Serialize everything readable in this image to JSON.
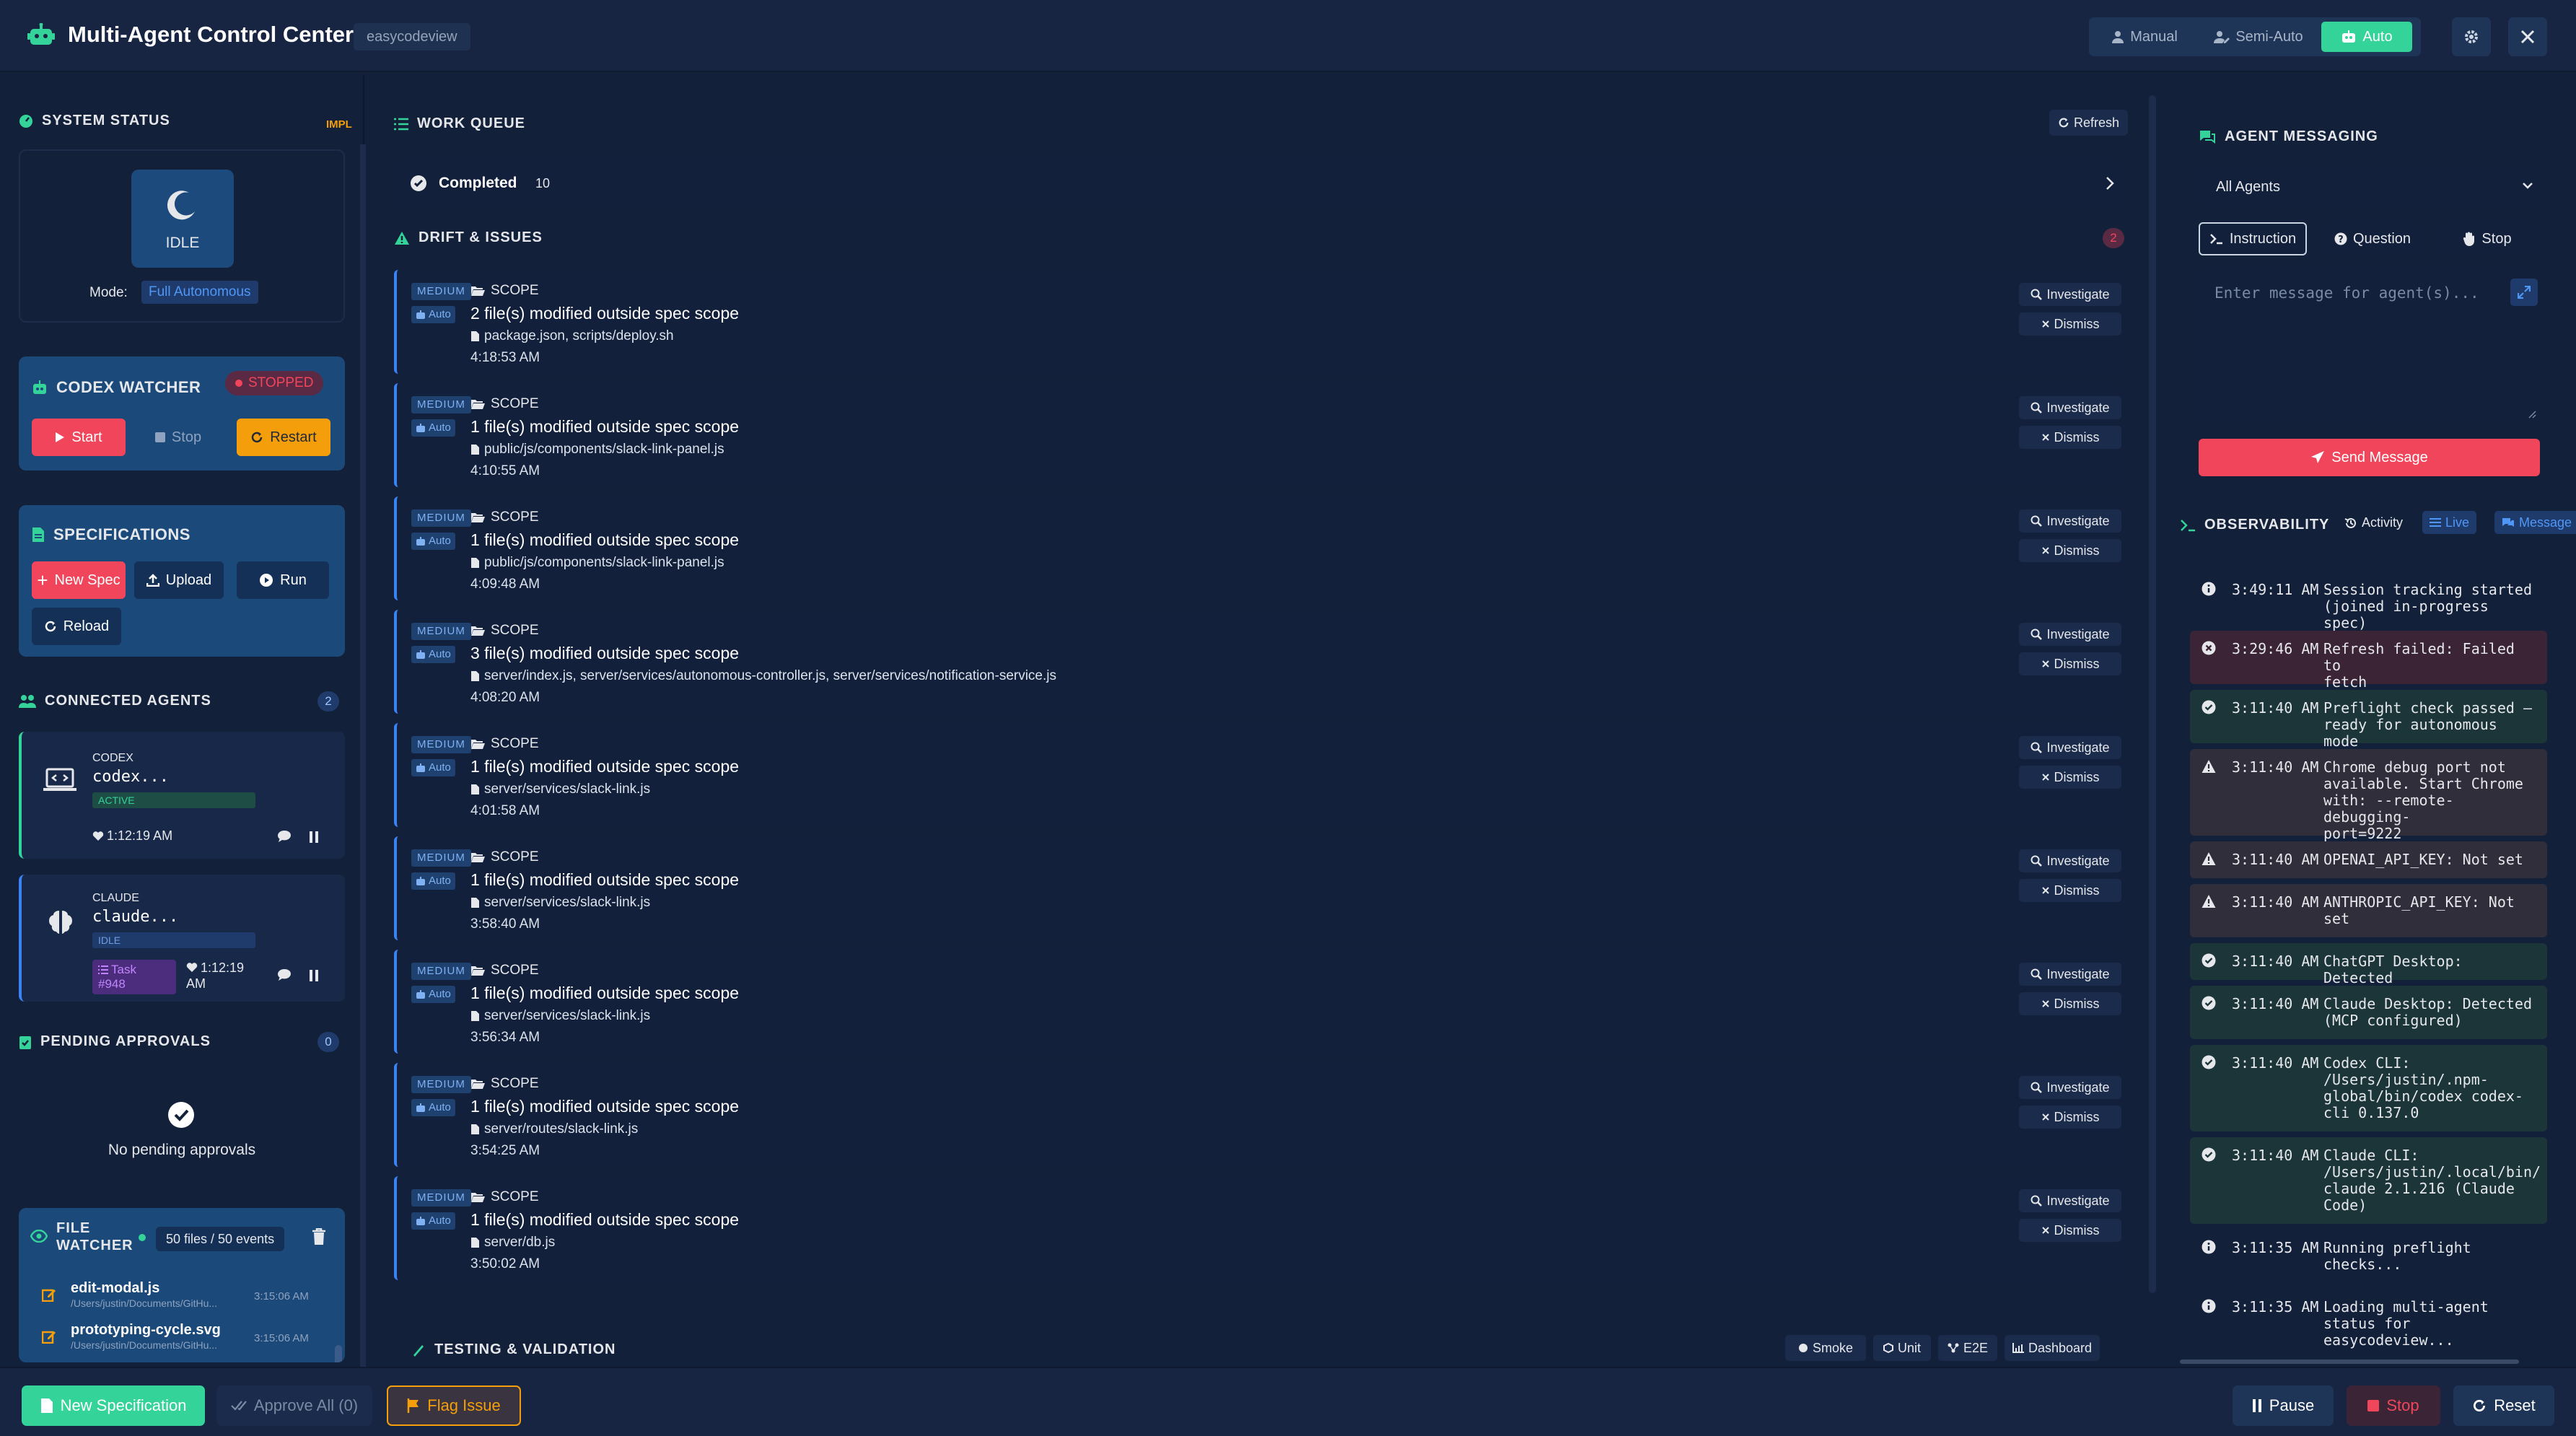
{
  "header": {
    "title": "Multi-Agent Control Center",
    "project": "easycodeview",
    "modes": [
      "Manual",
      "Semi-Auto",
      "Auto"
    ],
    "active_mode": "Auto"
  },
  "system_status": {
    "title": "SYSTEM STATUS",
    "corner_tag": "IMPL",
    "state": "IDLE",
    "mode_label": "Mode:",
    "mode_value": "Full Autonomous"
  },
  "codex_watcher": {
    "title": "CODEX WATCHER",
    "status": "STOPPED",
    "start": "Start",
    "stop": "Stop",
    "restart": "Restart"
  },
  "specifications": {
    "title": "SPECIFICATIONS",
    "new_spec": "New Spec",
    "upload": "Upload",
    "run": "Run",
    "reload": "Reload"
  },
  "connected_agents": {
    "title": "CONNECTED AGENTS",
    "count": "2",
    "agents": [
      {
        "label": "CODEX",
        "name": "codex...",
        "status": "ACTIVE",
        "heartbeat": "1:12:19 AM"
      },
      {
        "label": "CLAUDE",
        "name": "claude...",
        "status": "IDLE",
        "task_line1": "Task",
        "task_line2": "#948",
        "heartbeat_line1": "1:12:19",
        "heartbeat_line2": "AM"
      }
    ]
  },
  "pending_approvals": {
    "title": "PENDING APPROVALS",
    "count": "0",
    "empty": "No pending approvals"
  },
  "file_watcher": {
    "title_line1": "FILE",
    "title_line2": "WATCHER",
    "summary": "50 files / 50 events",
    "files": [
      {
        "name": "edit-modal.js",
        "path": "/Users/justin/Documents/GitHu...",
        "time": "3:15:06 AM"
      },
      {
        "name": "prototyping-cycle.svg",
        "path": "/Users/justin/Documents/GitHu...",
        "time": "3:15:06 AM"
      }
    ]
  },
  "work_queue": {
    "title": "WORK QUEUE",
    "refresh": "Refresh",
    "completed_label": "Completed",
    "completed_count": "10"
  },
  "drift": {
    "title": "DRIFT & ISSUES",
    "count": "2",
    "severity": "MEDIUM",
    "auto": "Auto",
    "investigate": "Investigate",
    "dismiss": "Dismiss",
    "issues": [
      {
        "category": "SCOPE",
        "message": "2 file(s) modified outside spec scope",
        "files": "package.json, scripts/deploy.sh",
        "time": "4:18:53 AM"
      },
      {
        "category": "SCOPE",
        "message": "1 file(s) modified outside spec scope",
        "files": "public/js/components/slack-link-panel.js",
        "time": "4:10:55 AM"
      },
      {
        "category": "SCOPE",
        "message": "1 file(s) modified outside spec scope",
        "files": "public/js/components/slack-link-panel.js",
        "time": "4:09:48 AM"
      },
      {
        "category": "SCOPE",
        "message": "3 file(s) modified outside spec scope",
        "files": "server/index.js, server/services/autonomous-controller.js, server/services/notification-service.js",
        "time": "4:08:20 AM"
      },
      {
        "category": "SCOPE",
        "message": "1 file(s) modified outside spec scope",
        "files": "server/services/slack-link.js",
        "time": "4:01:58 AM"
      },
      {
        "category": "SCOPE",
        "message": "1 file(s) modified outside spec scope",
        "files": "server/services/slack-link.js",
        "time": "3:58:40 AM"
      },
      {
        "category": "SCOPE",
        "message": "1 file(s) modified outside spec scope",
        "files": "server/services/slack-link.js",
        "time": "3:56:34 AM"
      },
      {
        "category": "SCOPE",
        "message": "1 file(s) modified outside spec scope",
        "files": "server/routes/slack-link.js",
        "time": "3:54:25 AM"
      },
      {
        "category": "SCOPE",
        "message": "1 file(s) modified outside spec scope",
        "files": "server/db.js",
        "time": "3:50:02 AM"
      }
    ]
  },
  "testing": {
    "title": "TESTING & VALIDATION",
    "buttons": [
      "Smoke",
      "Unit",
      "E2E",
      "Dashboard"
    ]
  },
  "messaging": {
    "title": "AGENT MESSAGING",
    "target": "All Agents",
    "tabs": [
      "Instruction",
      "Question",
      "Stop"
    ],
    "placeholder": "Enter message for agent(s)...",
    "send": "Send Message"
  },
  "observability": {
    "title": "OBSERVABILITY",
    "tabs": [
      "Activity",
      "Live",
      "Message"
    ],
    "logs": [
      {
        "kind": "info",
        "time": "3:49:11 AM",
        "lines": [
          "Session tracking started",
          "(joined in-progress spec)"
        ]
      },
      {
        "kind": "error",
        "time": "3:29:46 AM",
        "lines": [
          "Refresh failed: Failed to",
          "fetch"
        ]
      },
      {
        "kind": "success",
        "time": "3:11:40 AM",
        "lines": [
          "Preflight check passed –",
          "ready for autonomous mode"
        ]
      },
      {
        "kind": "warning",
        "time": "3:11:40 AM",
        "lines": [
          "Chrome debug port not",
          "available. Start Chrome",
          "with: --remote-debugging-",
          "port=9222"
        ]
      },
      {
        "kind": "warning",
        "time": "3:11:40 AM",
        "lines": [
          "OPENAI_API_KEY: Not set"
        ]
      },
      {
        "kind": "warning",
        "time": "3:11:40 AM",
        "lines": [
          "ANTHROPIC_API_KEY: Not",
          "set"
        ]
      },
      {
        "kind": "success",
        "time": "3:11:40 AM",
        "lines": [
          "ChatGPT Desktop: Detected"
        ]
      },
      {
        "kind": "success",
        "time": "3:11:40 AM",
        "lines": [
          "Claude Desktop: Detected",
          "(MCP configured)"
        ]
      },
      {
        "kind": "success",
        "time": "3:11:40 AM",
        "lines": [
          "Codex CLI:",
          "/Users/justin/.npm-",
          "global/bin/codex codex-",
          "cli 0.137.0"
        ]
      },
      {
        "kind": "success",
        "time": "3:11:40 AM",
        "lines": [
          "Claude CLI:",
          "/Users/justin/.local/bin/",
          "claude 2.1.216 (Claude",
          "Code)"
        ]
      },
      {
        "kind": "info",
        "time": "3:11:35 AM",
        "lines": [
          "Running preflight",
          "checks..."
        ]
      },
      {
        "kind": "info",
        "time": "3:11:35 AM",
        "lines": [
          "Loading multi-agent",
          "status for",
          "easycodeview..."
        ]
      }
    ]
  },
  "footer": {
    "new_spec": "New Specification",
    "approve_all": "Approve All (0)",
    "flag_issue": "Flag Issue",
    "pause": "Pause",
    "stop": "Stop",
    "reset": "Reset"
  },
  "colors": {
    "background": "#13203a",
    "accent_green": "#34d399",
    "accent_red": "#f0455a",
    "accent_orange": "#f59e0b",
    "accent_blue": "#3b82f6"
  }
}
